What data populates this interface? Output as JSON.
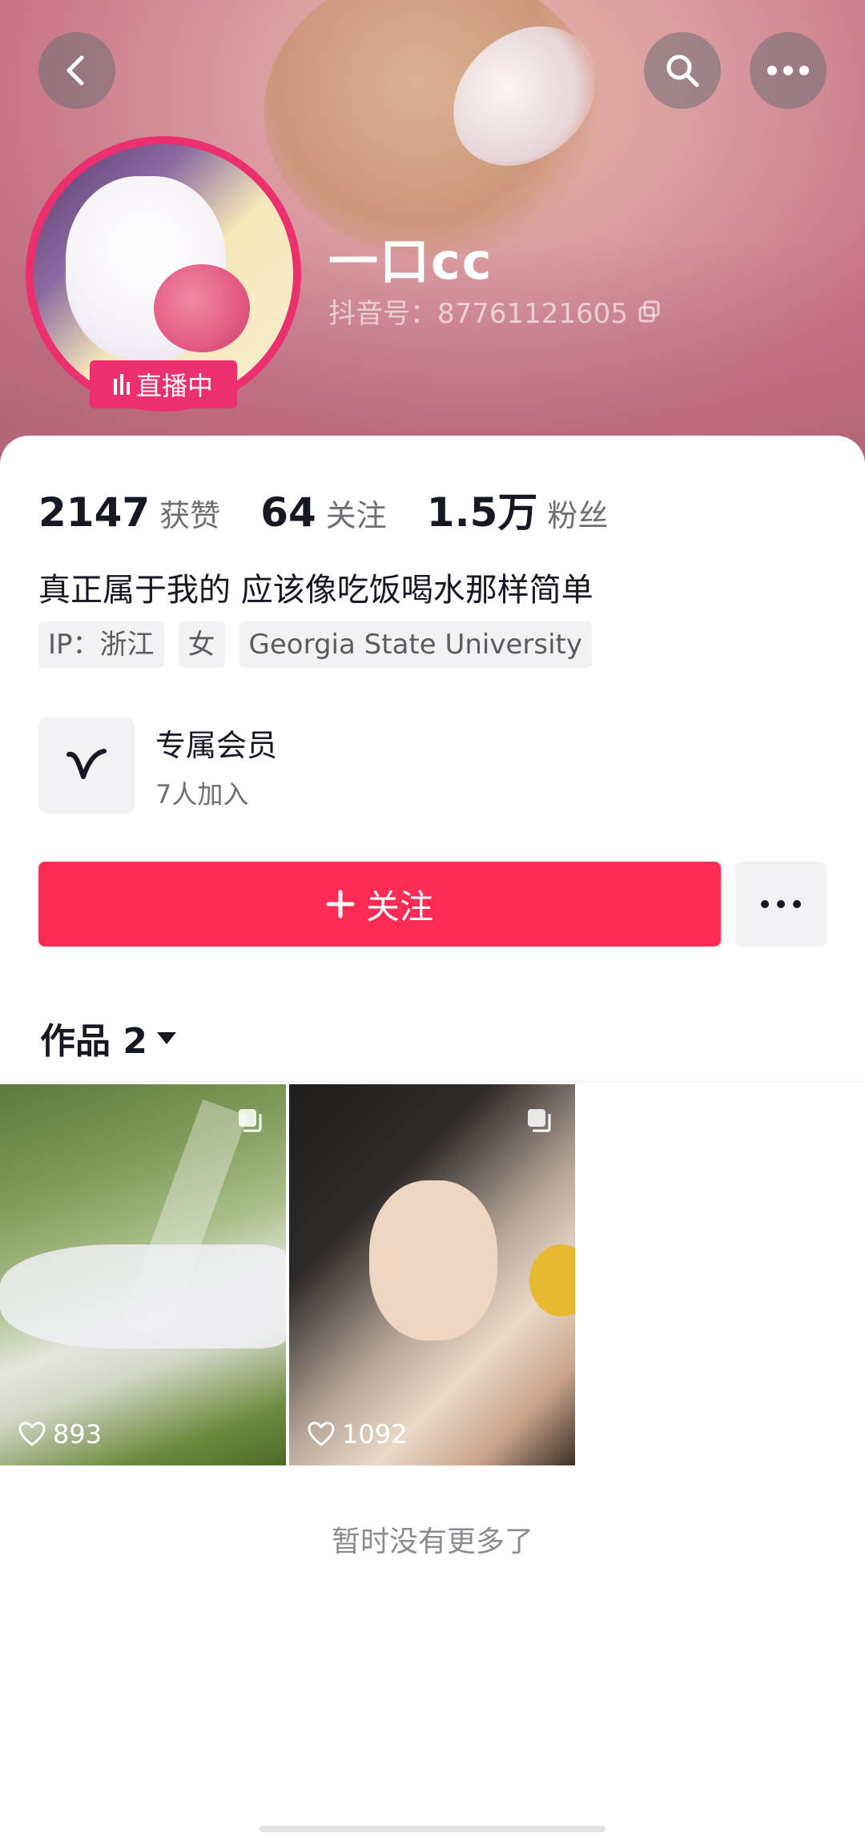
{
  "header": {
    "nickname": "一口cc",
    "douyin_id": "抖音号：87761121605",
    "live_label": "直播中"
  },
  "stats": [
    {
      "value": "2147",
      "label": "获赞"
    },
    {
      "value": "64",
      "label": "关注"
    },
    {
      "value": "1.5万",
      "label": "粉丝"
    }
  ],
  "bio": "真正属于我的 应该像吃饭喝水那样简单",
  "tags": [
    "IP：浙江",
    "女",
    "Georgia State University"
  ],
  "member": {
    "title": "专属会员",
    "subtitle": "7人加入"
  },
  "actions": {
    "follow_label": "关注"
  },
  "works": {
    "tab_label": "作品 2",
    "items": [
      {
        "likes": "893"
      },
      {
        "likes": "1092"
      }
    ],
    "end_text": "暂时没有更多了"
  },
  "colors": {
    "accent": "#fe2c55",
    "live": "#ec2f6f"
  }
}
